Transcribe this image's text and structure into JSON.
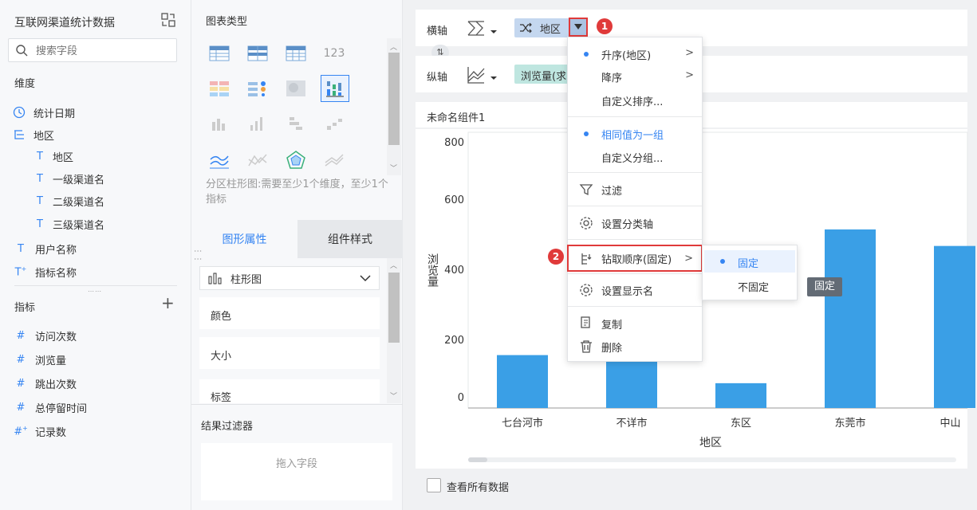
{
  "left": {
    "title": "互联网渠道统计数据",
    "search_placeholder": "搜索字段",
    "dim_label": "维度",
    "dims": {
      "date": "统计日期",
      "region_group": "地区",
      "region": "地区",
      "ch1": "一级渠道名",
      "ch2": "二级渠道名",
      "ch3": "三级渠道名",
      "user": "用户名称",
      "metric_name": "指标名称"
    },
    "metric_label": "指标",
    "metrics": {
      "visits": "访问次数",
      "views": "浏览量",
      "bounce": "跳出次数",
      "stay": "总停留时间",
      "records": "记录数"
    }
  },
  "mid": {
    "chart_type_label": "图表类型",
    "chart_hint": "分区柱形图:需要至少1个维度，至少1个指标",
    "tab_attr": "图形属性",
    "tab_style": "组件样式",
    "chart_select": "柱形图",
    "props": {
      "color": "颜色",
      "size": "大小",
      "label": "标签"
    },
    "filter_label": "结果过滤器",
    "drop_hint": "拖入字段"
  },
  "axes": {
    "x_label": "横轴",
    "y_label": "纵轴",
    "x_field": "地区",
    "y_field": "浏览量(求"
  },
  "component": {
    "name": "未命名组件1",
    "view_all": "查看所有数据"
  },
  "menu": {
    "asc": "升序(地区)",
    "desc": "降序",
    "custom_sort": "自定义排序...",
    "group_same": "相同值为一组",
    "custom_group": "自定义分组...",
    "filter": "过滤",
    "set_axis": "设置分类轴",
    "drill": "钻取顺序(固定)",
    "display_name": "设置显示名",
    "copy": "复制",
    "delete": "删除"
  },
  "submenu": {
    "fixed": "固定",
    "not_fixed": "不固定"
  },
  "tooltip": "固定",
  "badges": {
    "one": "1",
    "two": "2"
  },
  "colors": {
    "accent": "#3685f2",
    "bar": "#3a9fe6",
    "highlight": "#e03a3a"
  },
  "chart_data": {
    "type": "bar",
    "categories": [
      "七台河市",
      "不详市",
      "东区",
      "东莞市",
      "中山"
    ],
    "values": [
      160,
      150,
      75,
      540,
      490
    ],
    "ylabel": "浏览量",
    "xlabel": "地区",
    "ylim": [
      0,
      800
    ],
    "yticks": [
      "800",
      "600",
      "400",
      "200",
      "0"
    ]
  }
}
